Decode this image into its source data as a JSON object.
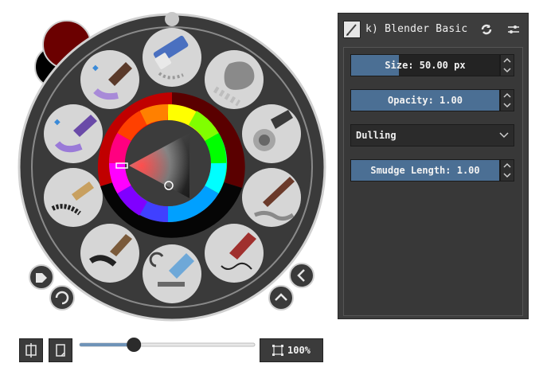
{
  "palette": {
    "colors": {
      "foreground": "#6b0000",
      "background": "#000000",
      "ring_dark": "#3c3c3c",
      "ring_light": "#c8c8c8"
    },
    "wheel": {
      "hue_ring": "rainbow",
      "selected_hue_color": "#ff0000"
    },
    "presets": [
      {
        "name": "eraser-brush-icon"
      },
      {
        "name": "blur-texture-brush-icon"
      },
      {
        "name": "airbrush-soft-icon"
      },
      {
        "name": "paint-smudge-brush-icon"
      },
      {
        "name": "pencil-sketch-icon"
      },
      {
        "name": "marker-blender-icon"
      },
      {
        "name": "bristle-brush-dark-icon"
      },
      {
        "name": "rough-bristle-brush-icon"
      },
      {
        "name": "watercolor-purple-brush-icon"
      },
      {
        "name": "wet-purple-brush-icon"
      }
    ]
  },
  "brush_panel": {
    "preset_name": "k) Blender Basic",
    "size": {
      "label": "Size: 50.00 px",
      "fill_fraction": 0.32
    },
    "opacity": {
      "label": "Opacity: 1.00",
      "fill_fraction": 1.0
    },
    "blend_mode": {
      "selected": "Dulling"
    },
    "smudge_length": {
      "label": "Smudge Length: 1.00",
      "fill_fraction": 1.0
    },
    "accent": "#4b6f94"
  },
  "toolbar": {
    "zoom_label": "100%",
    "zoom_fraction": 0.31
  }
}
